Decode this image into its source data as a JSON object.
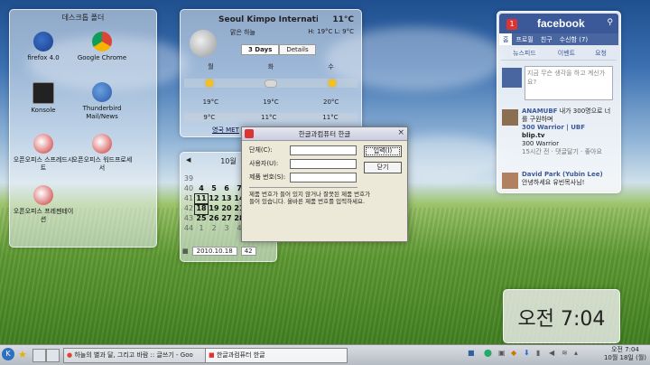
{
  "desktop_folder": {
    "title": "데스크톱 폴더",
    "items": [
      {
        "label": "firefox 4.0",
        "icon": "firefox-icon"
      },
      {
        "label": "Google Chrome",
        "icon": "chrome-icon"
      },
      {
        "label": "Konsole",
        "icon": "terminal-icon"
      },
      {
        "label": "Thunderbird Mail/News",
        "icon": "thunderbird-icon"
      },
      {
        "label": "오픈오피스 스프레드시트",
        "icon": "spreadsheet-icon"
      },
      {
        "label": "오픈오피스 워드프로세서",
        "icon": "wordprocessor-icon"
      },
      {
        "label": "오픈오피스 프레젠테이션",
        "icon": "presentation-icon"
      }
    ]
  },
  "weather": {
    "location": "Seoul Kimpo International",
    "temp": "11°C",
    "condition": "맑은 하늘",
    "high_low": "H: 19°C L: 9°C",
    "tabs": [
      "3 Days",
      "Details"
    ],
    "days": [
      "월",
      "화",
      "수"
    ],
    "highs": [
      "19°C",
      "19°C",
      "20°C"
    ],
    "lows": [
      "9°C",
      "11°C",
      "11°C"
    ],
    "source": "영국 MET"
  },
  "calendar": {
    "month": "10월",
    "rows": [
      [
        "",
        "",
        "",
        "",
        ""
      ],
      [
        "39",
        "",
        "",
        "",
        ""
      ],
      [
        "40",
        "4",
        "5",
        "6",
        "7"
      ],
      [
        "41",
        "11",
        "12",
        "13",
        "14"
      ],
      [
        "42",
        "18",
        "19",
        "20",
        "21"
      ],
      [
        "43",
        "25",
        "26",
        "27",
        "28"
      ],
      [
        "44",
        "1",
        "2",
        "3",
        "4"
      ]
    ],
    "date": "2010.10.18",
    "week": "42"
  },
  "facebook": {
    "badge": "1",
    "logo": "facebook",
    "nav": [
      "홈",
      "프로필",
      "친구",
      "수신함 (7)"
    ],
    "subtabs": [
      "뉴스피드",
      "이벤트",
      "요청"
    ],
    "status_placeholder": "지금 무슨 생각을 하고 계신가요?",
    "posts": [
      {
        "name": "ANAMUBF",
        "text": "내가 300명으로 너를 구원하며",
        "link": "300 Warrior | UBF",
        "site": "blip.tv",
        "sub": "300 Warrior",
        "meta": "15시간 전 · 댓글달기 · 좋아요"
      },
      {
        "name": "David Park",
        "name_extra": "(Yubin Lee)",
        "text": "안녕하세요 유빈목사님!"
      }
    ]
  },
  "clock": {
    "text": "오전 7:04"
  },
  "dialog": {
    "title": "한글과컴퓨터 한글",
    "fields": [
      "단체(C):",
      "사용자(U):",
      "제품 번호(S):"
    ],
    "buttons": [
      "입력(I)",
      "닫기"
    ],
    "message": "제품 번호가 들어 있지 않거나 잘못된 제품 번호가 들어 있습니다. 올바른 제품 번호를 입력하세요."
  },
  "taskbar": {
    "tasks": [
      {
        "label": "하늘의 별과 달, 그리고 바람 :: 글쓰기 - Goo"
      },
      {
        "label": "한글과컴퓨터 한글"
      }
    ],
    "clock_time": "오전 7:04",
    "clock_date": "10월 18일 (월)"
  }
}
